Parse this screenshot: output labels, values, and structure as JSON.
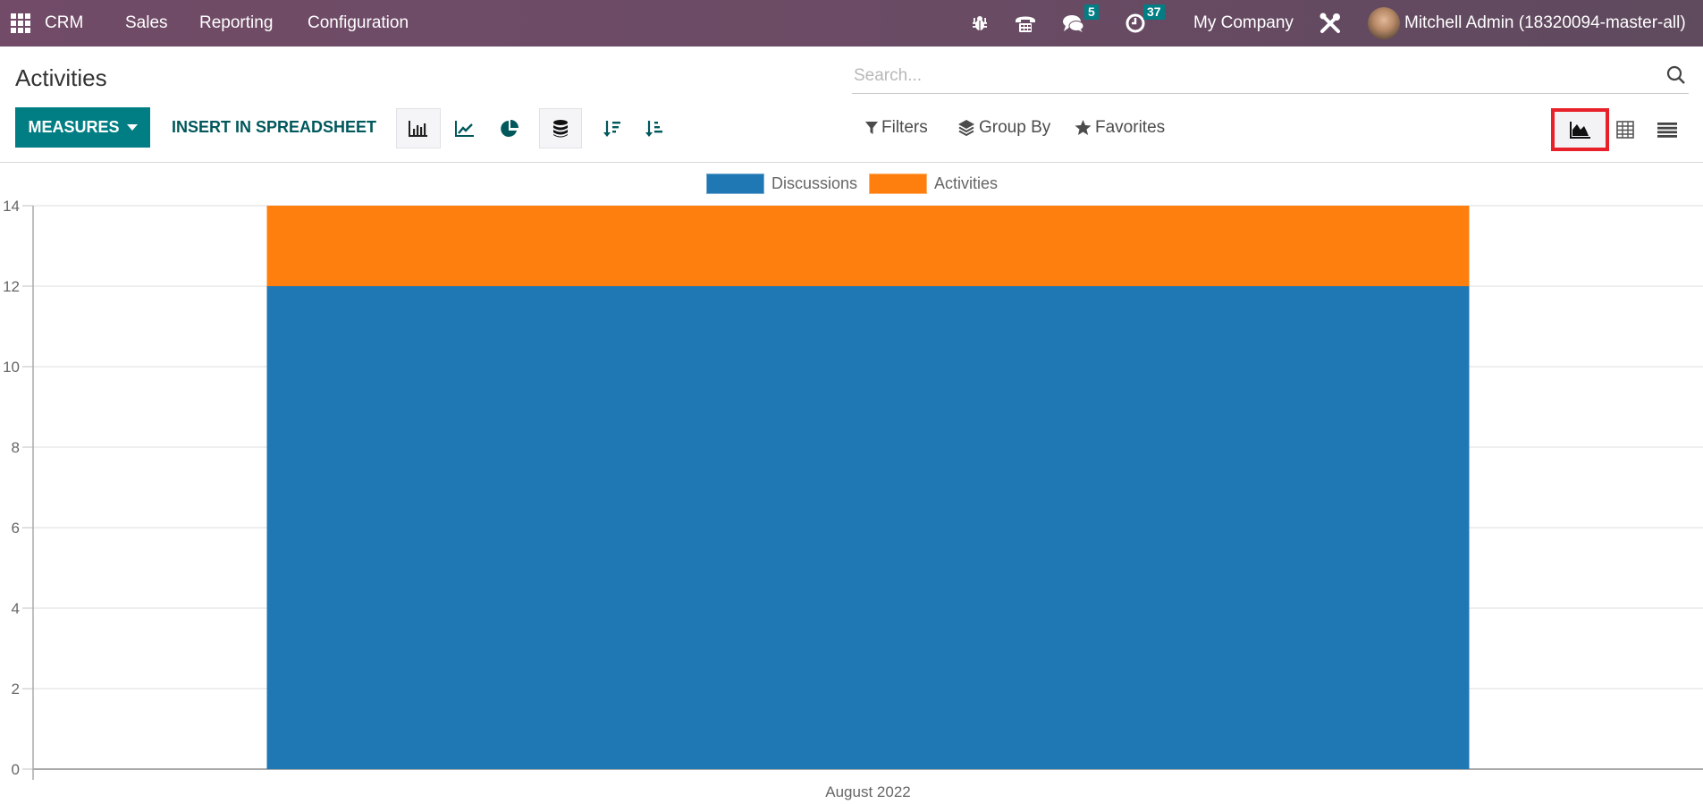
{
  "topbar": {
    "app_name": "CRM",
    "menu": [
      "Sales",
      "Reporting",
      "Configuration"
    ],
    "messages_count": "5",
    "activities_count": "37",
    "company": "My Company",
    "user": "Mitchell Admin (18320094-master-all)",
    "icons": [
      "apps-grid-icon",
      "bug-icon",
      "phone-icon",
      "chat-icon",
      "clock-icon",
      "tools-icon"
    ]
  },
  "page": {
    "title": "Activities",
    "search_placeholder": "Search..."
  },
  "toolbar": {
    "measures_label": "MEASURES",
    "insert_label": "INSERT IN SPREADSHEET",
    "chart_type_active": "bar",
    "stacked": true,
    "filters_label": "Filters",
    "groupby_label": "Group By",
    "favorites_label": "Favorites",
    "view_active": "graph"
  },
  "colors": {
    "brand": "#714b67",
    "primary": "#017e84",
    "highlight": "#e8202a"
  },
  "chart_data": {
    "type": "bar",
    "stacked": true,
    "categories": [
      "August 2022"
    ],
    "series": [
      {
        "name": "Discussions",
        "color": "#1f77b4",
        "values": [
          12
        ]
      },
      {
        "name": "Activities",
        "color": "#ff7f0e",
        "values": [
          2
        ]
      }
    ],
    "title": "",
    "xlabel": "",
    "ylabel": "",
    "ylim": [
      0,
      14
    ],
    "yticks": [
      0,
      2,
      4,
      6,
      8,
      10,
      12,
      14
    ],
    "grid": true,
    "legend": "top-center"
  }
}
